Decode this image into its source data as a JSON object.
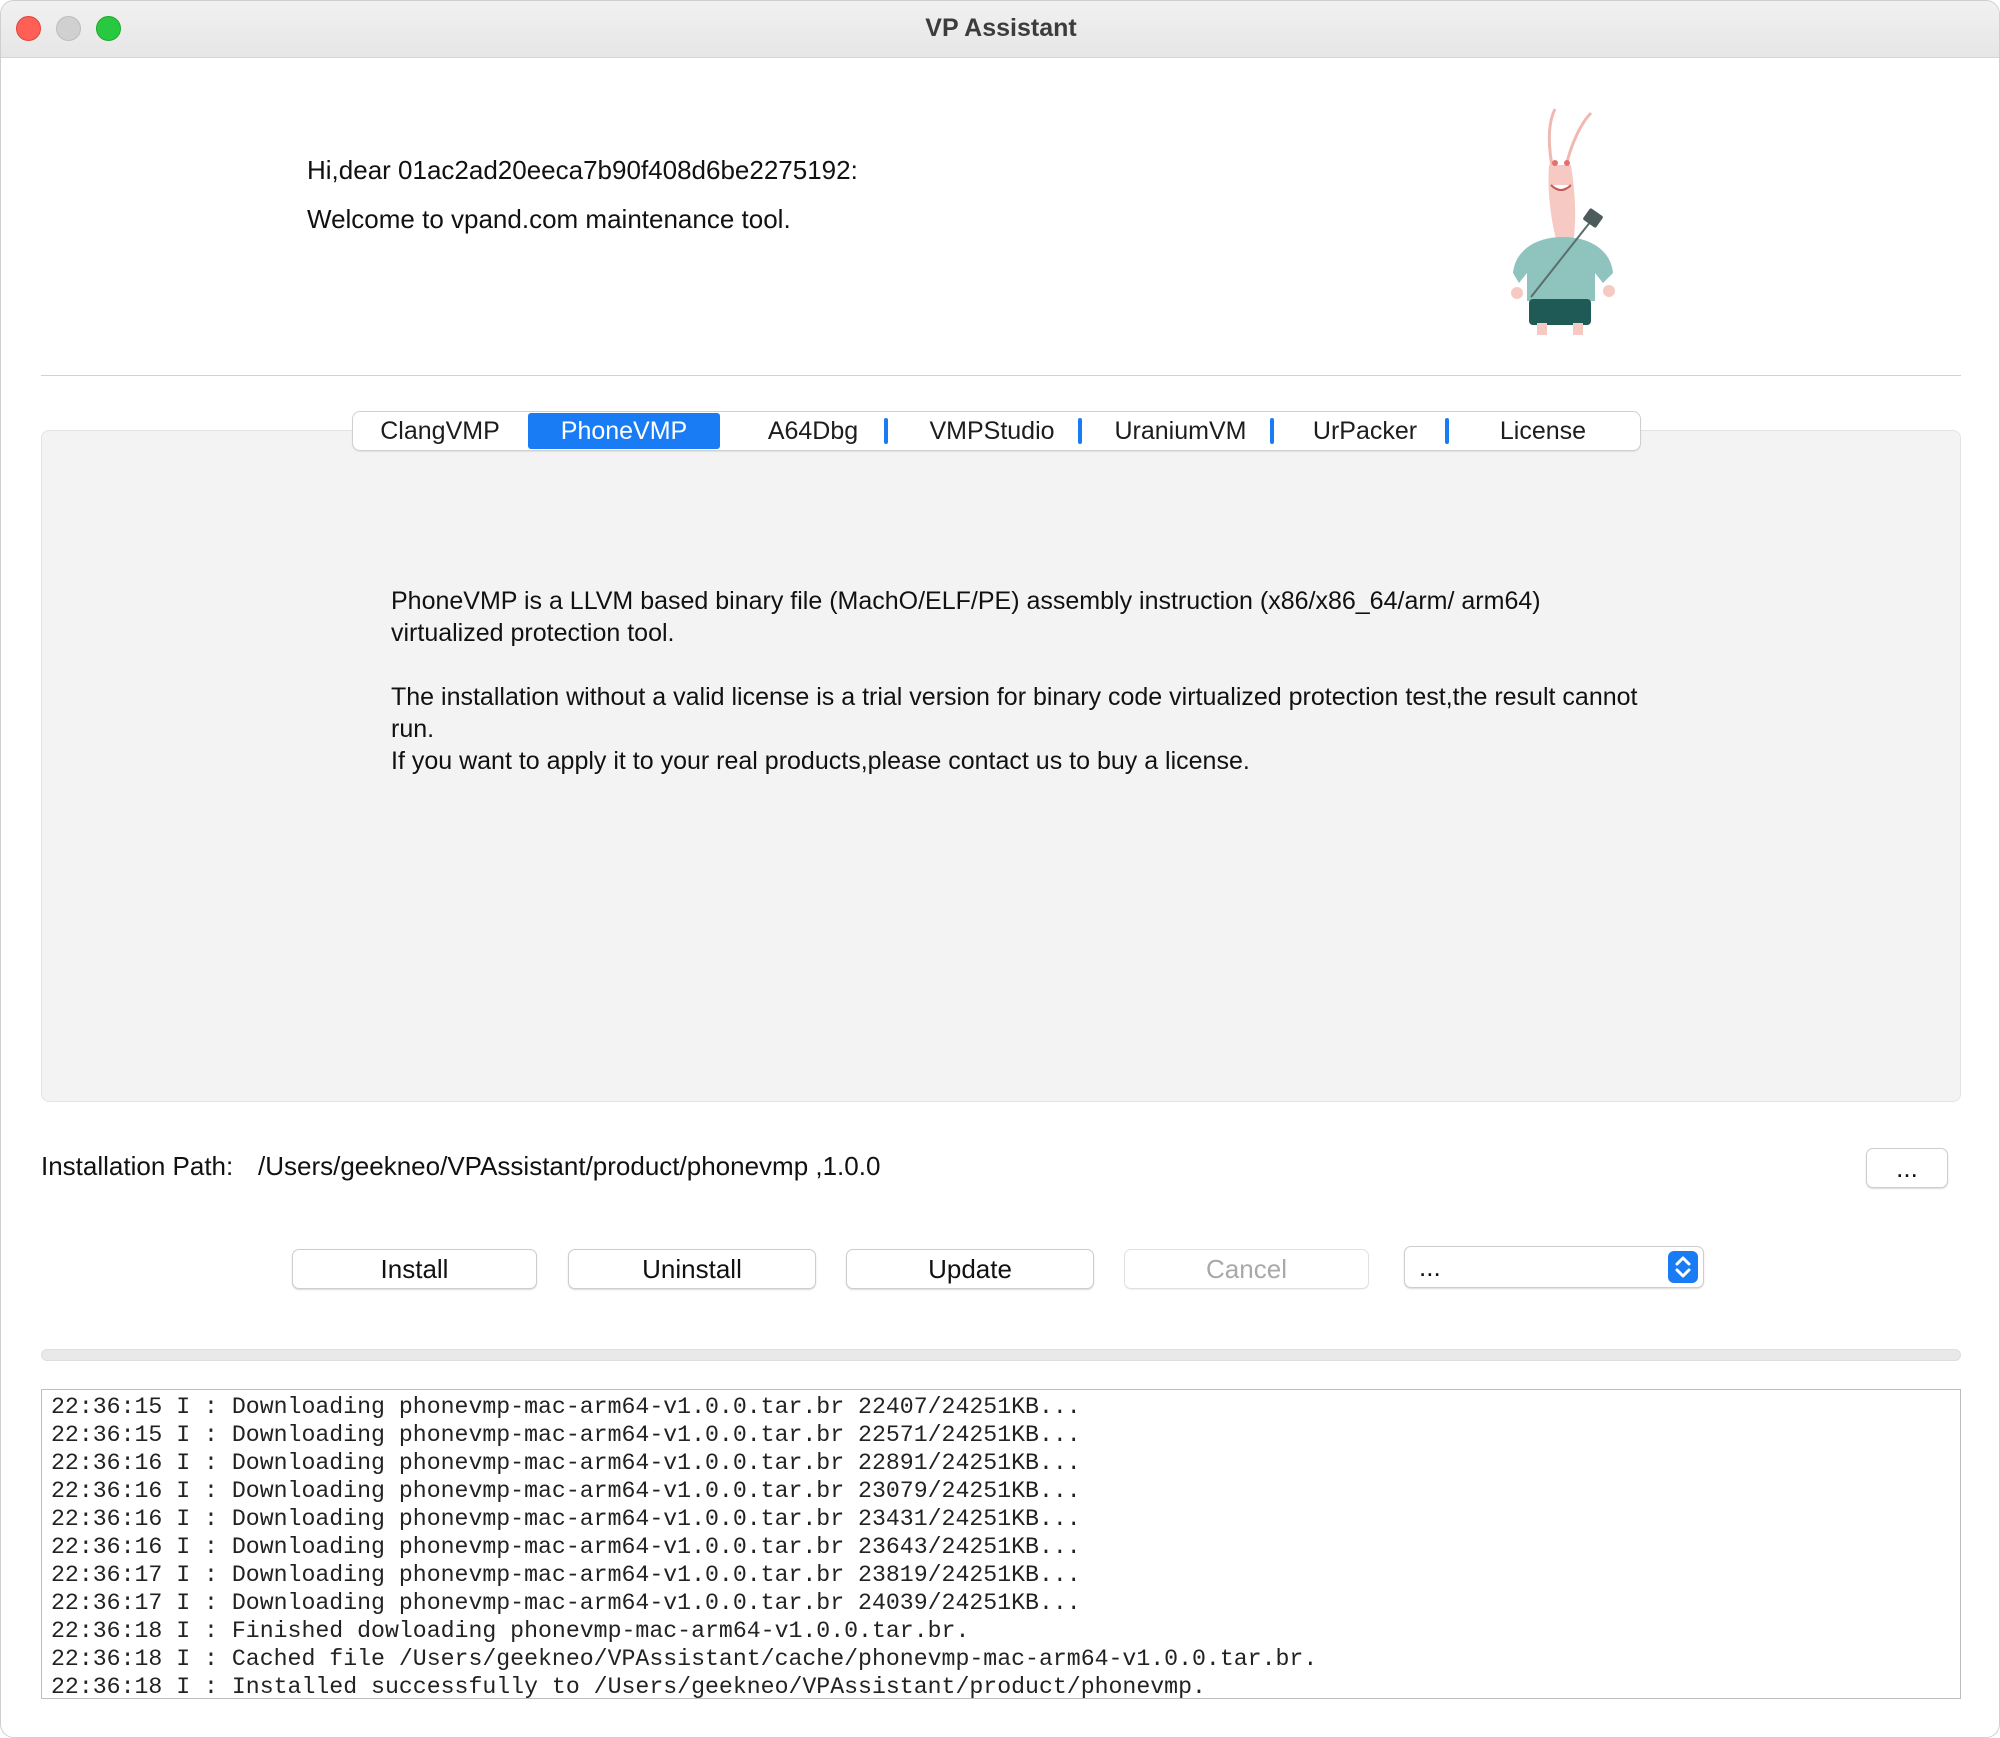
{
  "window": {
    "title": "VP Assistant"
  },
  "header": {
    "greeting": "Hi,dear 01ac2ad20eeca7b90f408d6be2275192:",
    "welcome": "Welcome to vpand.com maintenance tool.",
    "mascot_icon": "rabbit-mascot-icon"
  },
  "tabs": [
    {
      "label": "ClangVMP",
      "active": false
    },
    {
      "label": "PhoneVMP",
      "active": true
    },
    {
      "label": "A64Dbg",
      "active": false
    },
    {
      "label": "VMPStudio",
      "active": false
    },
    {
      "label": "UraniumVM",
      "active": false
    },
    {
      "label": "UrPacker",
      "active": false
    },
    {
      "label": "License",
      "active": false
    }
  ],
  "description": {
    "p1": "PhoneVMP is a LLVM based binary file (MachO/ELF/PE) assembly instruction (x86/x86_64/arm/ arm64) virtualized protection tool.",
    "p2": "The installation without a valid license is a trial version for binary code virtualized protection test,the result cannot run.",
    "p3": "If you want to apply it to your real products,please contact us to buy a license."
  },
  "install_path": {
    "label": "Installation Path:",
    "value": "/Users/geekneo/VPAssistant/product/phonevmp ,1.0.0",
    "browse_label": "..."
  },
  "actions": {
    "install": "Install",
    "uninstall": "Uninstall",
    "update": "Update",
    "cancel": "Cancel",
    "select_value": "..."
  },
  "progress": {
    "percent": 0
  },
  "log": [
    "22:36:15 I : Downloading phonevmp-mac-arm64-v1.0.0.tar.br 22407/24251KB...",
    "22:36:15 I : Downloading phonevmp-mac-arm64-v1.0.0.tar.br 22571/24251KB...",
    "22:36:16 I : Downloading phonevmp-mac-arm64-v1.0.0.tar.br 22891/24251KB...",
    "22:36:16 I : Downloading phonevmp-mac-arm64-v1.0.0.tar.br 23079/24251KB...",
    "22:36:16 I : Downloading phonevmp-mac-arm64-v1.0.0.tar.br 23431/24251KB...",
    "22:36:16 I : Downloading phonevmp-mac-arm64-v1.0.0.tar.br 23643/24251KB...",
    "22:36:17 I : Downloading phonevmp-mac-arm64-v1.0.0.tar.br 23819/24251KB...",
    "22:36:17 I : Downloading phonevmp-mac-arm64-v1.0.0.tar.br 24039/24251KB...",
    "22:36:18 I : Finished dowloading phonevmp-mac-arm64-v1.0.0.tar.br.",
    "22:36:18 I : Cached file /Users/geekneo/VPAssistant/cache/phonevmp-mac-arm64-v1.0.0.tar.br.",
    "22:36:18 I : Installed successfully to /Users/geekneo/VPAssistant/product/phonevmp."
  ],
  "colors": {
    "accent": "#1a7cf5",
    "close": "#fe5f57",
    "maximize": "#28c840"
  }
}
